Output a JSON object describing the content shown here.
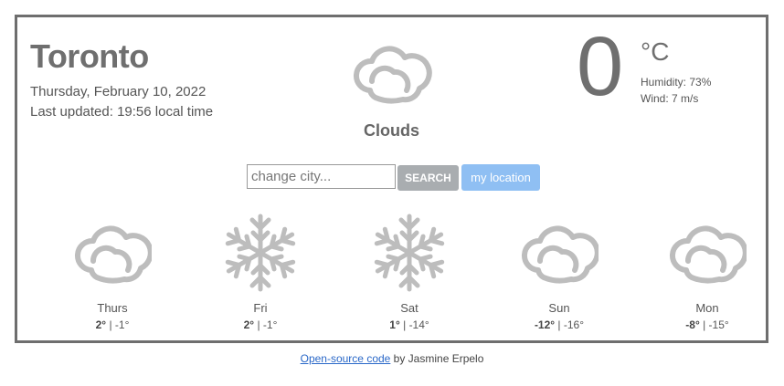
{
  "current": {
    "city": "Toronto",
    "date": "Thursday, February 10, 2022",
    "last_updated": "Last updated: 19:56 local time",
    "condition": "Clouds",
    "condition_icon": "cloud-icon",
    "temperature": "0",
    "unit": "°C",
    "humidity": "Humidity: 73%",
    "wind": "Wind: 7 m/s"
  },
  "search": {
    "placeholder": "change city...",
    "value": "",
    "search_label": "SEARCH",
    "location_label": "my location"
  },
  "forecast": [
    {
      "day": "Thurs",
      "icon": "cloud-icon",
      "high": "2°",
      "low": "-1°"
    },
    {
      "day": "Fri",
      "icon": "snowflake-icon",
      "high": "2°",
      "low": "-1°"
    },
    {
      "day": "Sat",
      "icon": "snowflake-icon",
      "high": "1°",
      "low": "-14°"
    },
    {
      "day": "Sun",
      "icon": "cloud-icon",
      "high": "-12°",
      "low": "-16°"
    },
    {
      "day": "Mon",
      "icon": "cloud-icon",
      "high": "-8°",
      "low": "-15°"
    }
  ],
  "footer": {
    "link_text": "Open-source code",
    "by_text": " by Jasmine Erpelo"
  },
  "colors": {
    "icon_gray": "#bdbdbd",
    "border": "#6e6e6e",
    "search_button": "#a9adb0",
    "location_button": "#8fbff3",
    "link": "#2a68c8"
  }
}
